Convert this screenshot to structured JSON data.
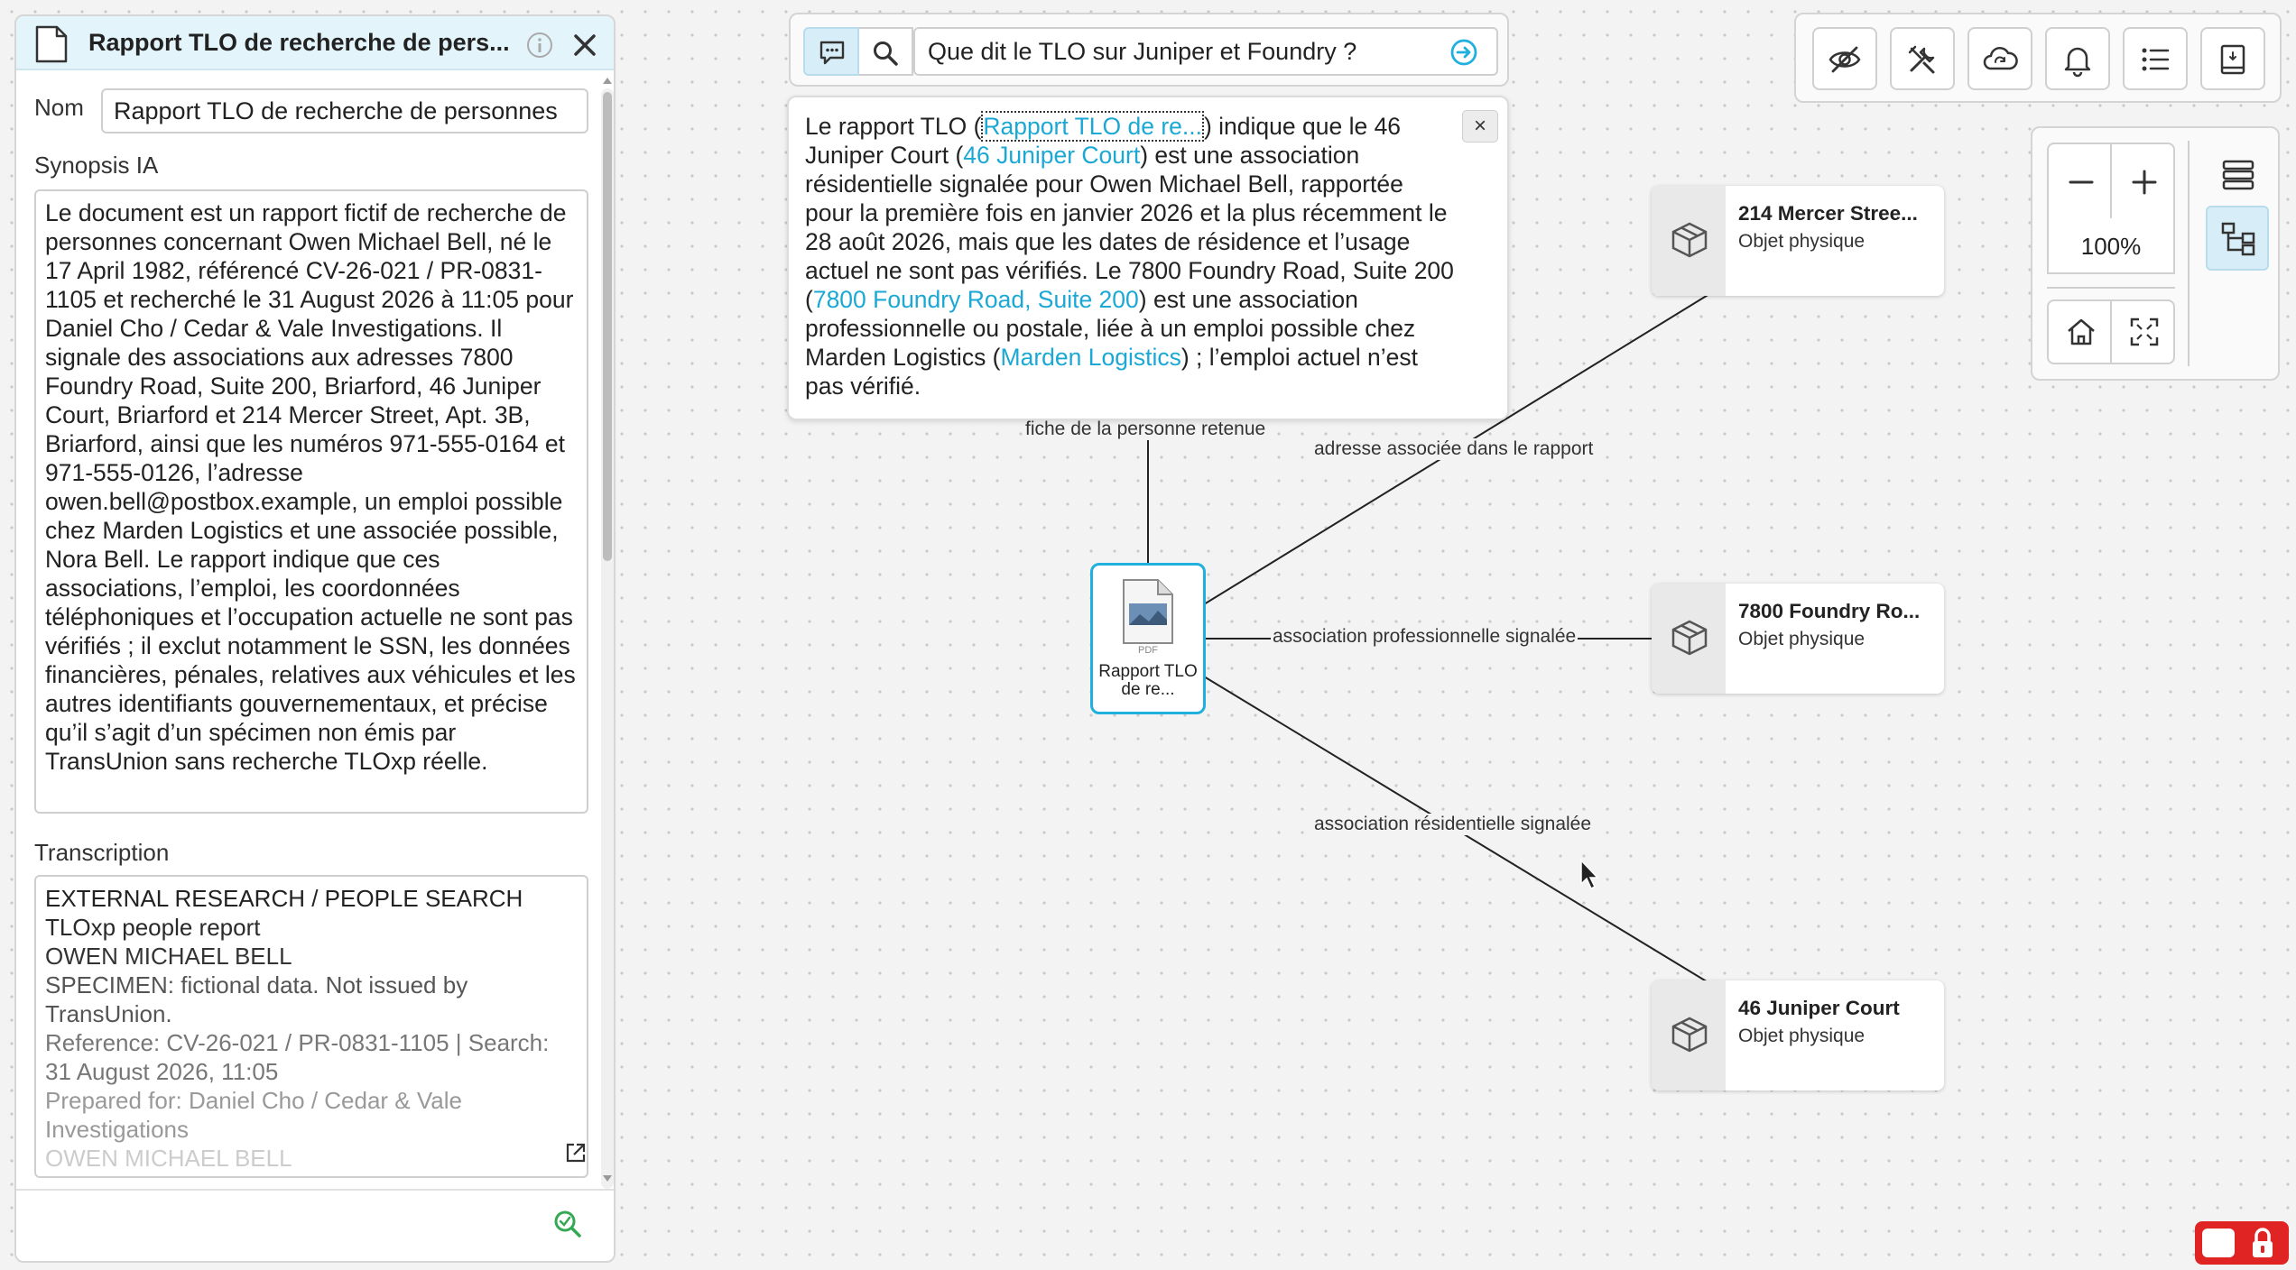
{
  "panel": {
    "title": "Rapport TLO de recherche de pers...",
    "name_label": "Nom",
    "name_value": "Rapport TLO de recherche de personnes",
    "synopsis_label": "Synopsis IA",
    "synopsis": "Le document est un rapport fictif de recherche de personnes concernant Owen Michael Bell, né le 17 April 1982, référencé CV-26-021 / PR-0831-1105 et recherché le 31 August 2026 à 11:05 pour Daniel Cho / Cedar & Vale Investigations. Il signale des associations aux adresses 7800 Foundry Road, Suite 200, Briarford, 46 Juniper Court, Briarford et 214 Mercer Street, Apt. 3B, Briarford, ainsi que les numéros 971-555-0164 et 971-555-0126, l’adresse owen.bell@postbox.example, un emploi possible chez Marden Logistics et une associée possible, Nora Bell. Le rapport indique que ces associations, l’emploi, les coordonnées téléphoniques et l’occupation actuelle ne sont pas vérifiés ; il exclut notamment le SSN, les données financières, pénales, relatives aux véhicules et les autres identifiants gouvernementaux, et précise qu’il s’agit d’un spécimen non émis par TransUnion sans recherche TLOxp réelle.",
    "transcription_label": "Transcription",
    "transcription_lines": [
      "EXTERNAL RESEARCH / PEOPLE SEARCH",
      "TLOxp people report",
      "OWEN MICHAEL BELL",
      "SPECIMEN: fictional data. Not issued by TransUnion.",
      "Reference: CV-26-021 / PR-0831-1105 | Search: 31 August 2026, 11:05",
      "Prepared for: Daniel Cho / Cedar & Vale Investigations",
      "OWEN MICHAEL BELL"
    ]
  },
  "search": {
    "query": "Que dit le TLO sur Juniper et Foundry ?"
  },
  "answer": {
    "p1": "Le rapport TLO (",
    "link1": "Rapport TLO de re...",
    "p2": ") indique que le 46 Juniper Court (",
    "link2": "46 Juniper Court",
    "p3": ") est une association résidentielle signalée pour Owen Michael Bell, rapportée pour la première fois en janvier 2026 et la plus récemment le 28 août 2026, mais que les dates de résidence et l’usage actuel ne sont pas vérifiés. Le 7800 Foundry Road, Suite 200 (",
    "link3": "7800 Foundry Road, Suite 200",
    "p4": ") est une association professionnelle ou postale, liée à un emploi possible chez Marden Logistics (",
    "link4": "Marden Logistics",
    "p5": ") ; l’emploi actuel n’est pas vérifié.",
    "close": "×"
  },
  "graph": {
    "doc_node_label": "Rapport TLO de re...",
    "doc_badge": "PDF",
    "entities": [
      {
        "title": "214 Mercer Stree...",
        "type": "Objet physique"
      },
      {
        "title": "7800 Foundry Ro...",
        "type": "Objet physique"
      },
      {
        "title": "46 Juniper Court",
        "type": "Objet physique"
      }
    ],
    "edges": [
      "fiche de la personne retenue",
      "adresse associée dans le rapport",
      "association professionnelle signalée",
      "association résidentielle signalée"
    ]
  },
  "zoom": {
    "level": "100%"
  },
  "colors": {
    "accent": "#1fb0dd",
    "link": "#1ba8d5",
    "lock": "#e02424",
    "header_bg": "#e3f4fb"
  }
}
